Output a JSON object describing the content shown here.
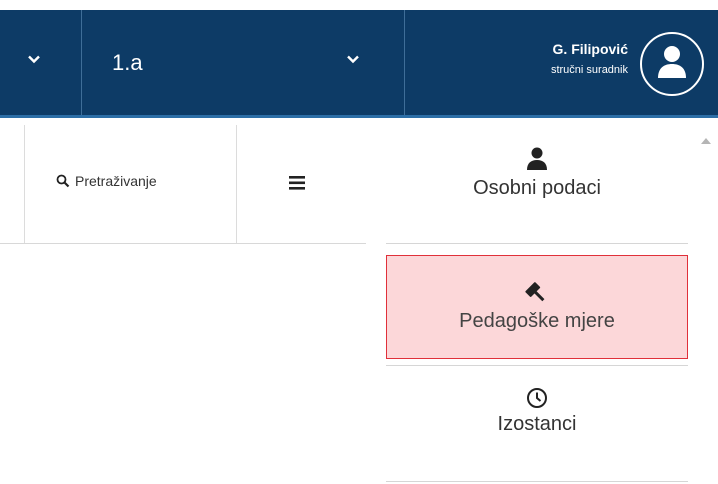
{
  "header": {
    "class_value": "1.a",
    "user_name": "G. Filipović",
    "user_role": "stručni suradnik",
    "colors": {
      "bar": "#0d3b66",
      "accent": "#2c6ea6"
    }
  },
  "toolbar": {
    "search_label": "Pretraživanje",
    "search_icon": "search-icon",
    "menu_icon": "hamburger-icon"
  },
  "side_menu": {
    "items": [
      {
        "label": "Osobni podaci",
        "icon": "person-icon",
        "active": false
      },
      {
        "label": "Pedagoške mjere",
        "icon": "gavel-icon",
        "active": true
      },
      {
        "label": "Izostanci",
        "icon": "clock-icon",
        "active": false
      }
    ],
    "active_color": "#fcd7d9",
    "active_border": "#e0303a"
  }
}
